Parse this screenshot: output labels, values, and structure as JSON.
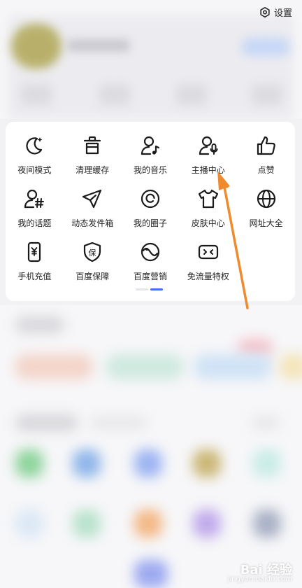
{
  "header": {
    "settings_label": "设置",
    "settings_icon": "gear-icon"
  },
  "menu": {
    "rows": [
      [
        {
          "label": "夜间模式",
          "icon": "moon-icon"
        },
        {
          "label": "清理缓存",
          "icon": "trash-icon"
        },
        {
          "label": "我的音乐",
          "icon": "music-user-icon"
        },
        {
          "label": "主播中心",
          "icon": "mic-user-icon"
        },
        {
          "label": "点赞",
          "icon": "thumbs-up-icon"
        }
      ],
      [
        {
          "label": "我的话题",
          "icon": "hashtag-user-icon"
        },
        {
          "label": "动态发件箱",
          "icon": "send-icon"
        },
        {
          "label": "我的圈子",
          "icon": "circle-icon"
        },
        {
          "label": "皮肤中心",
          "icon": "tshirt-icon"
        },
        {
          "label": "网址大全",
          "icon": "globe-icon"
        }
      ],
      [
        {
          "label": "手机充值",
          "icon": "phone-yen-icon"
        },
        {
          "label": "百度保障",
          "icon": "shield-bao-icon"
        },
        {
          "label": "百度营销",
          "icon": "marketing-icon"
        },
        {
          "label": "免流量特权",
          "icon": "data-free-icon"
        }
      ]
    ],
    "page_indicator": {
      "pages": 2,
      "current": 2
    }
  },
  "watermark": {
    "text": "Bai 经验",
    "sub": "jingyan.baidu.com"
  },
  "colors": {
    "accent": "#3e6ff4",
    "arrow": "#f08a2e",
    "icon": "#1a1a1a"
  }
}
